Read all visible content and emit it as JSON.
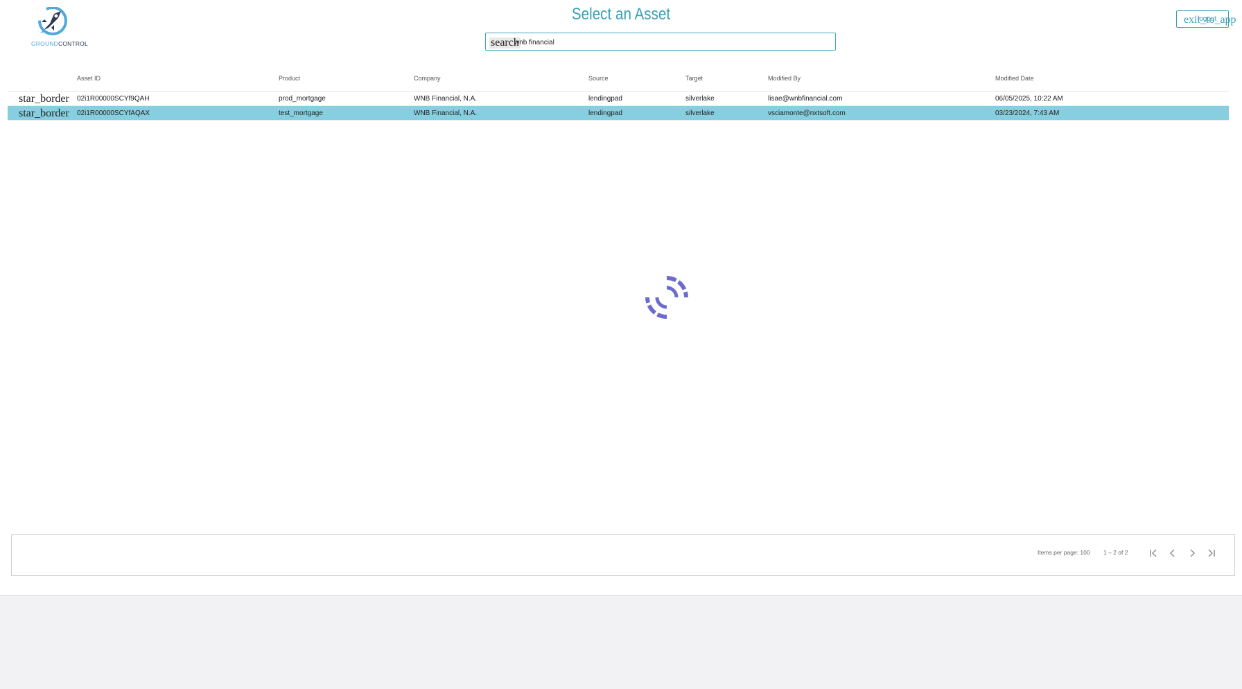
{
  "header": {
    "logo": {
      "text_left": "GROUND",
      "text_right": "CONTROL"
    },
    "title": "Select an Asset",
    "search": {
      "icon": "search",
      "value": "wnb financial"
    },
    "exit_button": {
      "icon": "exit_to_app",
      "label": "logout"
    }
  },
  "table": {
    "columns": [
      "Asset ID",
      "Product",
      "Company",
      "Source",
      "Target",
      "Modified By",
      "Modified Date"
    ],
    "rows": [
      {
        "star": "star_border",
        "asset_id": "02i1R00000SCYf9QAH",
        "product": "prod_mortgage",
        "company": "WNB Financial, N.A.",
        "source": "lendingpad",
        "target": "silverlake",
        "modified_by": "lisae@wnbfinancial.com",
        "modified_date": "06/05/2025, 10:22 AM",
        "selected": false
      },
      {
        "star": "star_border",
        "asset_id": "02i1R00000SCYfAQAX",
        "product": "test_mortgage",
        "company": "WNB Financial, N.A.",
        "source": "lendingpad",
        "target": "silverlake",
        "modified_by": "vsciamonte@nxtsoft.com",
        "modified_date": "03/23/2024, 7:43 AM",
        "selected": true
      }
    ]
  },
  "paginator": {
    "items_per_page": "Items per page: 100",
    "range": "1 – 2 of 2"
  },
  "colors": {
    "accent": "#3aa0b6",
    "selected_row": "#86cfe0",
    "spinner": "#6b6bd0"
  }
}
